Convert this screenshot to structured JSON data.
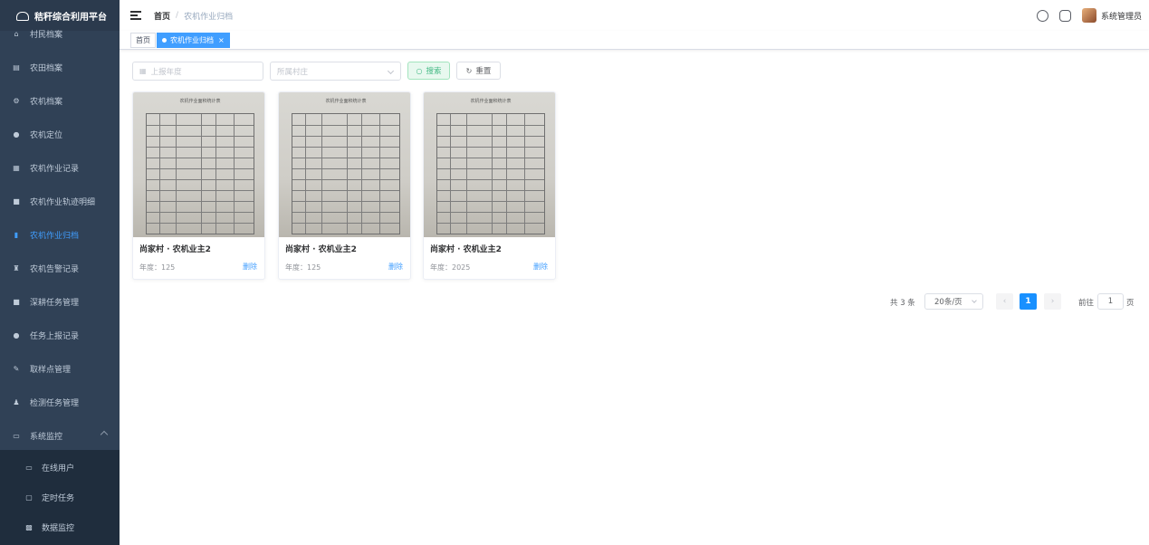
{
  "app": {
    "title": "秸秆综合利用平台"
  },
  "sidebar": {
    "items": [
      {
        "label": "村民档案",
        "icon": "user-icon"
      },
      {
        "label": "农田档案",
        "icon": "farm-icon"
      },
      {
        "label": "农机档案",
        "icon": "machine-icon"
      },
      {
        "label": "农机定位",
        "icon": "location-icon"
      },
      {
        "label": "农机作业记录",
        "icon": "record-icon"
      },
      {
        "label": "农机作业轨迹明细",
        "icon": "track-icon"
      },
      {
        "label": "农机作业归档",
        "icon": "archive-icon",
        "active": true
      },
      {
        "label": "农机告警记录",
        "icon": "alarm-icon"
      },
      {
        "label": "深耕任务管理",
        "icon": "task-icon"
      },
      {
        "label": "任务上报记录",
        "icon": "report-icon"
      },
      {
        "label": "取样点管理",
        "icon": "sample-icon"
      },
      {
        "label": "检测任务管理",
        "icon": "detect-icon"
      },
      {
        "label": "系统监控",
        "icon": "monitor-icon"
      }
    ],
    "subitems": [
      {
        "label": "在线用户",
        "icon": "online-icon"
      },
      {
        "label": "定时任务",
        "icon": "timer-icon"
      },
      {
        "label": "数据监控",
        "icon": "data-icon"
      }
    ]
  },
  "header": {
    "breadcrumb_home": "首页",
    "breadcrumb_sep": "/",
    "breadcrumb_current": "农机作业归档",
    "username": "系统管理员"
  },
  "tags": {
    "home": "首页",
    "current": "农机作业归档",
    "close": "×"
  },
  "filters": {
    "year_placeholder": "上报年度",
    "village_placeholder": "所属村庄",
    "search_label": "搜索",
    "reset_label": "重置"
  },
  "cards": [
    {
      "doc_title": "农机作业面积统计表",
      "title": "尚家村 · 农机业主2",
      "year": "年度：125",
      "delete": "删除"
    },
    {
      "doc_title": "农机作业面积统计表",
      "title": "尚家村 · 农机业主2",
      "year": "年度：125",
      "delete": "删除"
    },
    {
      "doc_title": "农机作业面积统计表",
      "title": "尚家村 · 农机业主2",
      "year": "年度：2025",
      "delete": "删除"
    }
  ],
  "pagination": {
    "total": "共 3 条",
    "page_size": "20条/页",
    "current": "1",
    "goto_label": "前往",
    "goto_value": "1",
    "page_unit": "页"
  }
}
